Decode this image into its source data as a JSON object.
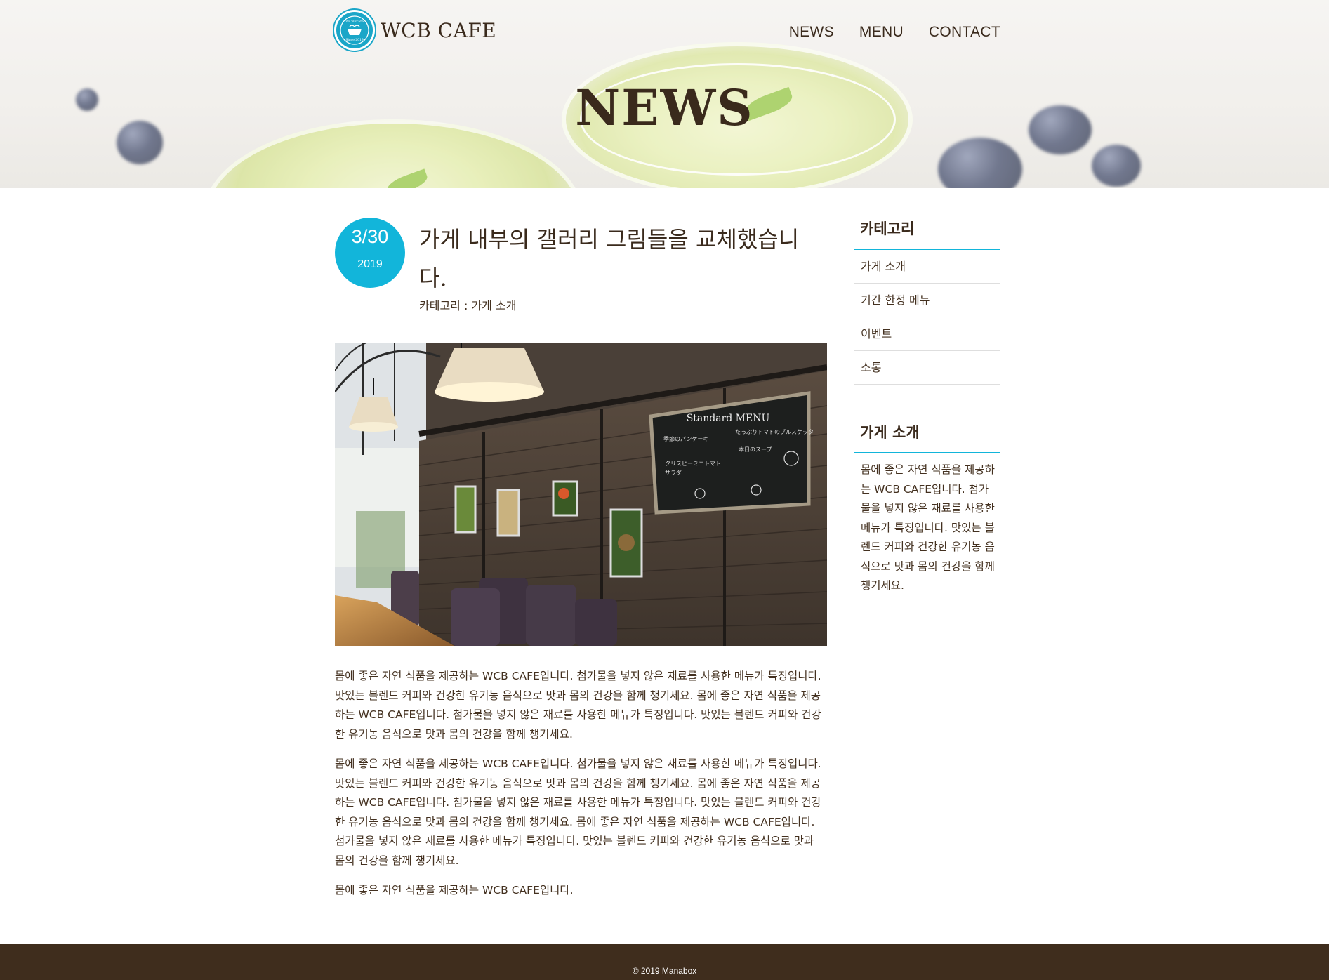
{
  "brand": {
    "name": "WCB CAFE",
    "mark_top": "WCB Cafe",
    "mark_bottom": "Since 2019",
    "accent": "#12b5da",
    "dark": "#3f2d1d"
  },
  "nav": {
    "items": [
      "NEWS",
      "MENU",
      "CONTACT"
    ]
  },
  "hero": {
    "title": "NEWS"
  },
  "post": {
    "date": "3/30",
    "year": "2019",
    "title": "가게 내부의 갤러리 그림들을 교체했습니다.",
    "category": "카테고리 : 가게 소개",
    "photo_icon": "cafe-interior-photo",
    "chalkboard": {
      "title": "Standard MENU",
      "lines": [
        "季節のパンケーキ",
        "たっぷりトマトのブルスケッタ",
        "本日のスープ",
        "クリスピーミニトマト",
        "サラダ"
      ]
    },
    "paragraphs": [
      "몸에 좋은 자연 식품을 제공하는 WCB CAFE입니다. 첨가물을 넣지 않은 재료를 사용한 메뉴가 특징입니다. 맛있는 블렌드 커피와 건강한 유기농 음식으로 맛과 몸의 건강을 함께 챙기세요. 몸에 좋은 자연 식품을 제공하는 WCB CAFE입니다. 첨가물을 넣지 않은 재료를 사용한 메뉴가 특징입니다. 맛있는 블렌드 커피와 건강한 유기농 음식으로 맛과 몸의 건강을 함께 챙기세요.",
      "몸에 좋은 자연 식품을 제공하는 WCB CAFE입니다. 첨가물을 넣지 않은 재료를 사용한 메뉴가 특징입니다. 맛있는 블렌드 커피와 건강한 유기농 음식으로 맛과 몸의 건강을 함께 챙기세요. 몸에 좋은 자연 식품을 제공하는 WCB CAFE입니다. 첨가물을 넣지 않은 재료를 사용한 메뉴가 특징입니다. 맛있는 블렌드 커피와 건강한 유기농 음식으로 맛과 몸의 건강을 함께 챙기세요. 몸에 좋은 자연 식품을 제공하는 WCB CAFE입니다. 첨가물을 넣지 않은 재료를 사용한 메뉴가 특징입니다. 맛있는 블렌드 커피와 건강한 유기농 음식으로 맛과 몸의 건강을 함께 챙기세요.",
      "몸에 좋은 자연 식품을 제공하는 WCB CAFE입니다."
    ]
  },
  "sidebar": {
    "category_heading": "카테고리",
    "categories": [
      "가게 소개",
      "기간 한정 메뉴",
      "이벤트",
      "소통"
    ],
    "about_heading": "가게 소개",
    "about_text": "몸에 좋은 자연 식품을 제공하는 WCB CAFE입니다. 첨가물을 넣지 않은 재료를 사용한 메뉴가 특징입니다. 맛있는 블렌드 커피와 건강한 유기농 음식으로 맛과 몸의 건강을 함께 챙기세요."
  },
  "footer": {
    "copyright": "© 2019 Manabox"
  }
}
